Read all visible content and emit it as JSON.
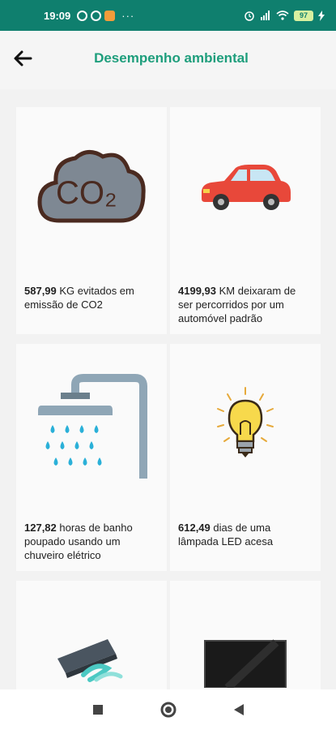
{
  "status_bar": {
    "time": "19:09",
    "notification_icons": [
      "whatsapp-icon",
      "whatsapp-icon",
      "app-icon"
    ],
    "more": "···",
    "battery": "97"
  },
  "header": {
    "title": "Desempenho ambiental",
    "back_icon": "arrow-left-icon"
  },
  "cards": [
    {
      "value": "587,99",
      "text": " KG evitados em emissão de CO2",
      "icon": "co2-cloud-icon",
      "icon_label": "CO₂"
    },
    {
      "value": "4199,93",
      "text": " KM deixaram de ser percorridos por um automóvel padrão",
      "icon": "car-icon"
    },
    {
      "value": "127,82",
      "text": " horas de banho poupado usando um chuveiro elétrico",
      "icon": "shower-icon"
    },
    {
      "value": "612,49",
      "text": " dias de uma lâmpada LED acesa",
      "icon": "lightbulb-icon"
    },
    {
      "value": "",
      "text": "",
      "icon": "air-conditioner-icon"
    },
    {
      "value": "",
      "text": "",
      "icon": "television-icon"
    }
  ],
  "nav": [
    "square-icon",
    "circle-icon",
    "triangle-back-icon"
  ],
  "colors": {
    "status_bar": "#0f7f6e",
    "title": "#1e9e7c",
    "accent": "#2ab0d8"
  }
}
